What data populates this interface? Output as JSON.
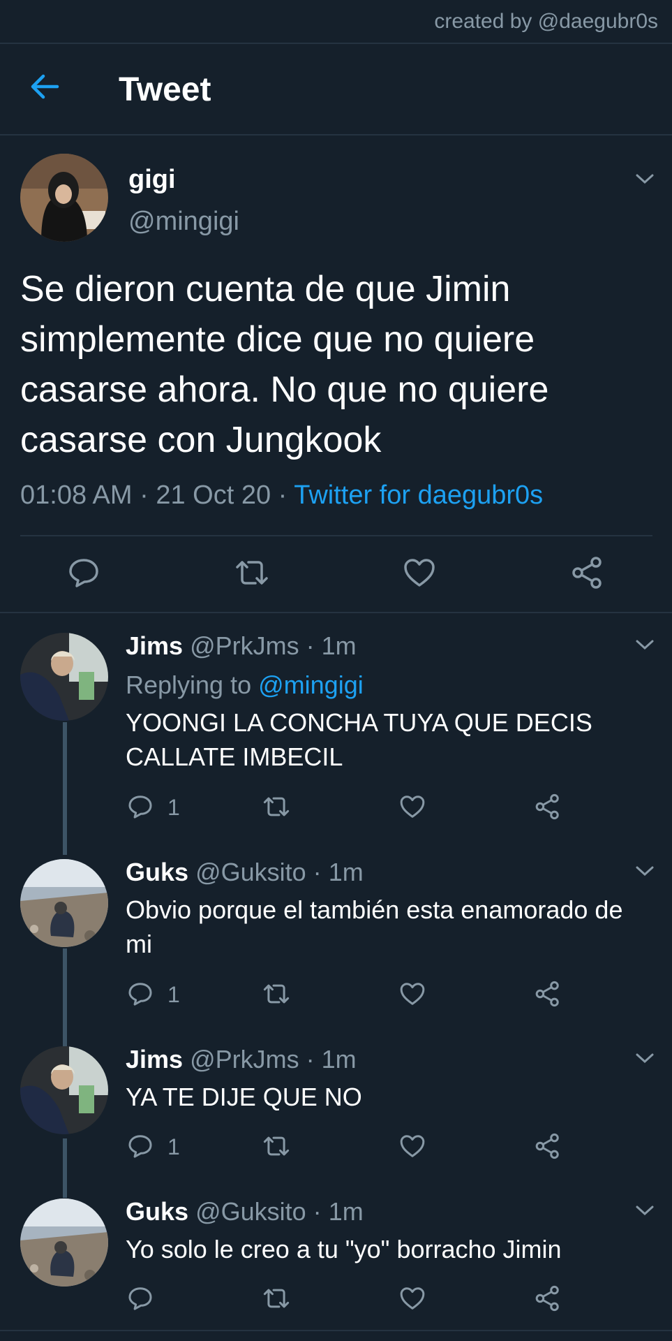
{
  "credit": "created by @daegubr0s",
  "header": {
    "title": "Tweet"
  },
  "tweet": {
    "name": "gigi",
    "handle": "@mingigi",
    "text": "Se dieron cuenta de que Jimin simplemente dice que no quiere casarse ahora. No que no quiere casarse con Jungkook",
    "time": "01:08 AM",
    "date": "21 Oct 20",
    "source": "Twitter for daegubr0s",
    "sep": "·"
  },
  "replies": [
    {
      "name": "Jims",
      "handle": "@PrkJms",
      "time": "1m",
      "replying_label": "Replying to",
      "replying_to": "@mingigi",
      "text": "YOONGI LA CONCHA TUYA QUE DECIS CALLATE IMBECIL",
      "reply_count": "1"
    },
    {
      "name": "Guks",
      "handle": "@Guksito",
      "time": "1m",
      "text": "Obvio porque el también esta enamorado de mi",
      "reply_count": "1"
    },
    {
      "name": "Jims",
      "handle": "@PrkJms",
      "time": "1m",
      "text": "YA TE DIJE QUE NO",
      "reply_count": "1"
    },
    {
      "name": "Guks",
      "handle": "@Guksito",
      "time": "1m",
      "text": "Yo solo le creo a tu \"yo\" borracho Jimin",
      "reply_count": ""
    }
  ],
  "icons": {
    "back": "arrow-left-icon",
    "reply": "speech-bubble-icon",
    "retweet": "retweet-icon",
    "like": "heart-icon",
    "share": "share-icon",
    "menu": "chevron-down-icon"
  },
  "colors": {
    "background": "#15202b",
    "accent": "#1da1f2",
    "muted": "#8899a6",
    "divider": "#253341"
  }
}
